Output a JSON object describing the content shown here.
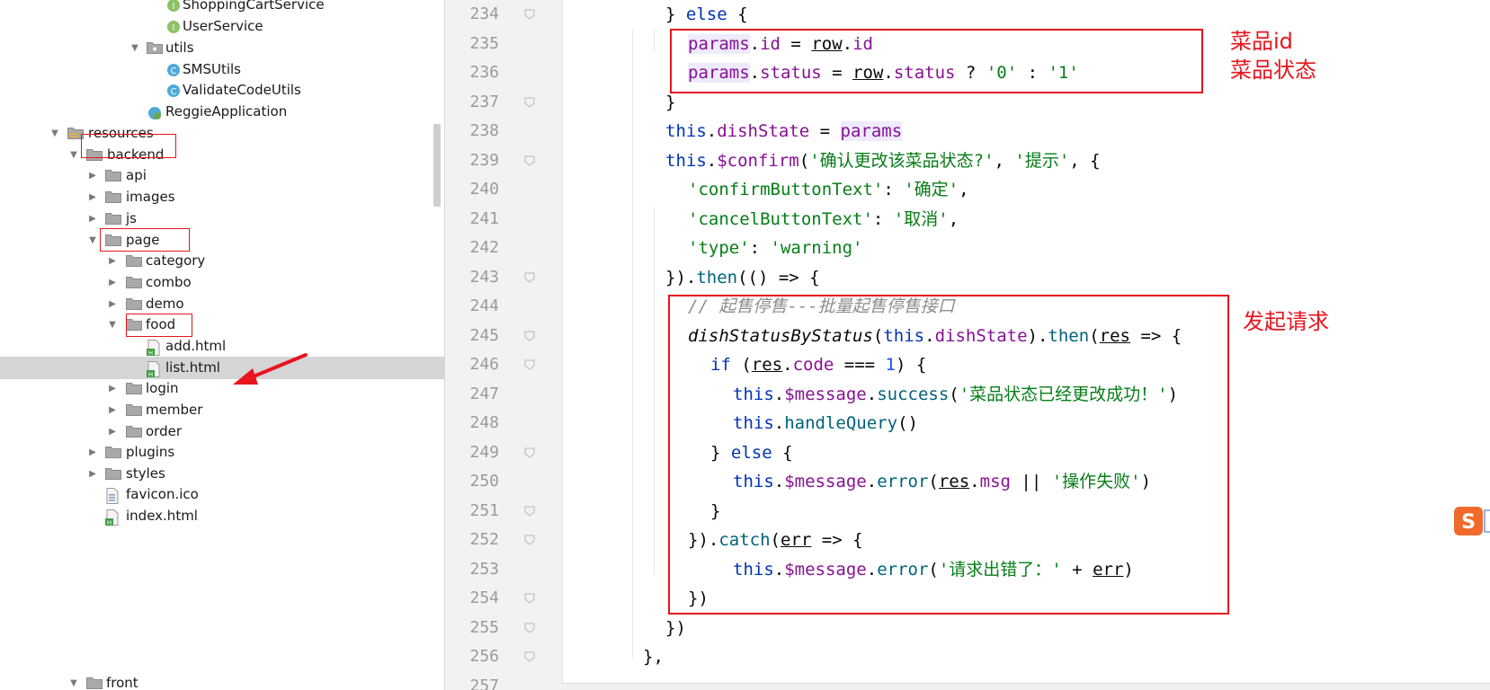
{
  "tree": {
    "items": [
      {
        "label": "ShoppingCartService",
        "icon": "interface-icon",
        "arrow": ""
      },
      {
        "label": "UserService",
        "icon": "interface-icon",
        "arrow": ""
      },
      {
        "label": "utils",
        "icon": "package-icon",
        "arrow": "expanded"
      },
      {
        "label": "SMSUtils",
        "icon": "class-icon",
        "arrow": ""
      },
      {
        "label": "ValidateCodeUtils",
        "icon": "class-icon",
        "arrow": ""
      },
      {
        "label": "ReggieApplication",
        "icon": "spring-boot-icon",
        "arrow": ""
      },
      {
        "label": "resources",
        "icon": "resources-folder-icon",
        "arrow": "expanded"
      },
      {
        "label": "backend",
        "icon": "folder-icon",
        "arrow": "expanded"
      },
      {
        "label": "api",
        "icon": "folder-icon",
        "arrow": "collapsed"
      },
      {
        "label": "images",
        "icon": "folder-icon",
        "arrow": "collapsed"
      },
      {
        "label": "js",
        "icon": "folder-icon",
        "arrow": "collapsed"
      },
      {
        "label": "page",
        "icon": "folder-icon",
        "arrow": "expanded"
      },
      {
        "label": "category",
        "icon": "folder-icon",
        "arrow": "collapsed"
      },
      {
        "label": "combo",
        "icon": "folder-icon",
        "arrow": "collapsed"
      },
      {
        "label": "demo",
        "icon": "folder-icon",
        "arrow": "collapsed"
      },
      {
        "label": "food",
        "icon": "folder-icon",
        "arrow": "expanded"
      },
      {
        "label": "add.html",
        "icon": "html-file-icon",
        "arrow": ""
      },
      {
        "label": "list.html",
        "icon": "html-file-icon",
        "arrow": ""
      },
      {
        "label": "login",
        "icon": "folder-icon",
        "arrow": "collapsed"
      },
      {
        "label": "member",
        "icon": "folder-icon",
        "arrow": "collapsed"
      },
      {
        "label": "order",
        "icon": "folder-icon",
        "arrow": "collapsed"
      },
      {
        "label": "plugins",
        "icon": "folder-icon",
        "arrow": "collapsed"
      },
      {
        "label": "styles",
        "icon": "folder-icon",
        "arrow": "collapsed"
      },
      {
        "label": "favicon.ico",
        "icon": "ico-file-icon",
        "arrow": ""
      },
      {
        "label": "index.html",
        "icon": "html-file-icon",
        "arrow": ""
      },
      {
        "label": "front",
        "icon": "folder-icon",
        "arrow": "expanded"
      }
    ],
    "selected_index": 17
  },
  "editor": {
    "lines": [
      {
        "num": "234",
        "tokens": [
          [
            "",
            "} "
          ],
          [
            "kw",
            "else"
          ],
          [
            "",
            " {"
          ]
        ]
      },
      {
        "num": "235",
        "tokens": [
          [
            "prop hl",
            "params"
          ],
          [
            "",
            "."
          ],
          [
            "prop",
            "id"
          ],
          [
            "",
            " = "
          ],
          [
            "ul",
            "row"
          ],
          [
            "",
            "."
          ],
          [
            "prop",
            "id"
          ]
        ]
      },
      {
        "num": "236",
        "tokens": [
          [
            "prop hl",
            "params"
          ],
          [
            "",
            "."
          ],
          [
            "prop",
            "status"
          ],
          [
            "",
            " = "
          ],
          [
            "ul",
            "row"
          ],
          [
            "",
            "."
          ],
          [
            "prop",
            "status"
          ],
          [
            "",
            " ? "
          ],
          [
            "str",
            "'0'"
          ],
          [
            "",
            " : "
          ],
          [
            "str",
            "'1'"
          ]
        ]
      },
      {
        "num": "237",
        "tokens": [
          [
            "",
            "}"
          ]
        ]
      },
      {
        "num": "238",
        "tokens": [
          [
            "kw",
            "this"
          ],
          [
            "",
            "."
          ],
          [
            "prop",
            "dishState"
          ],
          [
            "",
            " = "
          ],
          [
            "prop hl",
            "params"
          ]
        ]
      },
      {
        "num": "239",
        "tokens": [
          [
            "kw",
            "this"
          ],
          [
            "",
            "."
          ],
          [
            "prop",
            "$confirm"
          ],
          [
            "",
            "("
          ],
          [
            "str",
            "'确认更改该菜品状态?'"
          ],
          [
            "",
            ", "
          ],
          [
            "str",
            "'提示'"
          ],
          [
            "",
            ", {"
          ]
        ]
      },
      {
        "num": "240",
        "tokens": [
          [
            "str",
            "'confirmButtonText'"
          ],
          [
            "",
            ": "
          ],
          [
            "str",
            "'确定'"
          ],
          [
            "",
            ","
          ]
        ]
      },
      {
        "num": "241",
        "tokens": [
          [
            "str",
            "'cancelButtonText'"
          ],
          [
            "",
            ": "
          ],
          [
            "str",
            "'取消'"
          ],
          [
            "",
            ","
          ]
        ]
      },
      {
        "num": "242",
        "tokens": [
          [
            "str",
            "'type'"
          ],
          [
            "",
            ": "
          ],
          [
            "str",
            "'warning'"
          ]
        ]
      },
      {
        "num": "243",
        "tokens": [
          [
            "",
            "})."
          ],
          [
            "fn",
            "then"
          ],
          [
            "",
            "(() => {"
          ]
        ]
      },
      {
        "num": "244",
        "tokens": [
          [
            "cmt",
            "// 起售停售---批量起售停售接口"
          ]
        ]
      },
      {
        "num": "245",
        "tokens": [
          [
            "it",
            "dishStatusByStatus"
          ],
          [
            "",
            "("
          ],
          [
            "kw",
            "this"
          ],
          [
            "",
            "."
          ],
          [
            "prop",
            "dishState"
          ],
          [
            "",
            ")."
          ],
          [
            "fn",
            "then"
          ],
          [
            "",
            "("
          ],
          [
            "ul",
            "res"
          ],
          [
            "",
            " => {"
          ]
        ]
      },
      {
        "num": "246",
        "tokens": [
          [
            "kw",
            "if"
          ],
          [
            "",
            " ("
          ],
          [
            "ul",
            "res"
          ],
          [
            "",
            "."
          ],
          [
            "prop",
            "code"
          ],
          [
            "",
            " === "
          ],
          [
            "num",
            "1"
          ],
          [
            "",
            ") {"
          ]
        ]
      },
      {
        "num": "247",
        "tokens": [
          [
            "kw",
            "this"
          ],
          [
            "",
            "."
          ],
          [
            "prop",
            "$message"
          ],
          [
            "",
            "."
          ],
          [
            "fn",
            "success"
          ],
          [
            "",
            "("
          ],
          [
            "str",
            "'菜品状态已经更改成功！'"
          ],
          [
            "",
            ")"
          ]
        ]
      },
      {
        "num": "248",
        "tokens": [
          [
            "kw",
            "this"
          ],
          [
            "",
            "."
          ],
          [
            "fn",
            "handleQuery"
          ],
          [
            "",
            "()"
          ]
        ]
      },
      {
        "num": "249",
        "tokens": [
          [
            "",
            "} "
          ],
          [
            "kw",
            "else"
          ],
          [
            "",
            " {"
          ]
        ]
      },
      {
        "num": "250",
        "tokens": [
          [
            "kw",
            "this"
          ],
          [
            "",
            "."
          ],
          [
            "prop",
            "$message"
          ],
          [
            "",
            "."
          ],
          [
            "fn",
            "error"
          ],
          [
            "",
            "("
          ],
          [
            "ul",
            "res"
          ],
          [
            "",
            "."
          ],
          [
            "prop",
            "msg"
          ],
          [
            "",
            " || "
          ],
          [
            "str",
            "'操作失败'"
          ],
          [
            "",
            ")"
          ]
        ]
      },
      {
        "num": "251",
        "tokens": [
          [
            "",
            "}"
          ]
        ]
      },
      {
        "num": "252",
        "tokens": [
          [
            "",
            "})."
          ],
          [
            "fn",
            "catch"
          ],
          [
            "",
            "("
          ],
          [
            "ul",
            "err"
          ],
          [
            "",
            " => {"
          ]
        ]
      },
      {
        "num": "253",
        "tokens": [
          [
            "kw",
            "this"
          ],
          [
            "",
            "."
          ],
          [
            "prop",
            "$message"
          ],
          [
            "",
            "."
          ],
          [
            "fn",
            "error"
          ],
          [
            "",
            "("
          ],
          [
            "str",
            "'请求出错了：'"
          ],
          [
            "",
            " + "
          ],
          [
            "ul",
            "err"
          ],
          [
            "",
            ")"
          ]
        ]
      },
      {
        "num": "254",
        "tokens": [
          [
            "",
            "})"
          ]
        ]
      },
      {
        "num": "255",
        "tokens": [
          [
            "",
            "})"
          ]
        ]
      },
      {
        "num": "256",
        "tokens": [
          [
            "",
            "},"
          ]
        ]
      },
      {
        "num": "257",
        "tokens": []
      }
    ]
  },
  "annotations": {
    "top": [
      "菜品id",
      "菜品状态"
    ],
    "request": "发起请求"
  },
  "colors": {
    "annotation_red": "#e8141e",
    "keyword": "#0033b3",
    "string": "#067d17",
    "property": "#871094",
    "function": "#00627a",
    "selection_row": "#d5d5d5"
  }
}
